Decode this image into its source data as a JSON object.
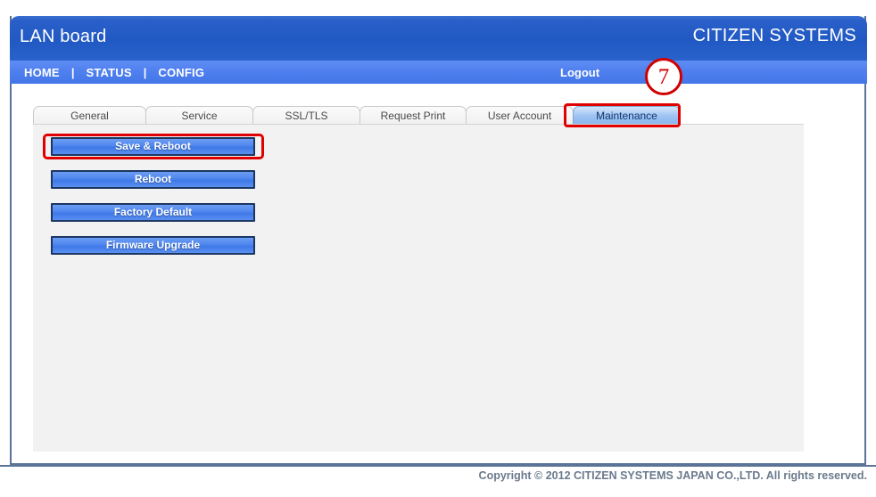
{
  "header": {
    "title": "LAN board",
    "brand": "CITIZEN SYSTEMS"
  },
  "nav": {
    "items": [
      {
        "label": "HOME"
      },
      {
        "label": "STATUS"
      },
      {
        "label": "CONFIG"
      }
    ],
    "separator": "|",
    "logout_label": "Logout"
  },
  "tabs": [
    {
      "label": "General",
      "active": false
    },
    {
      "label": "Service",
      "active": false
    },
    {
      "label": "SSL/TLS",
      "active": false
    },
    {
      "label": "Request Print",
      "active": false
    },
    {
      "label": "User Account",
      "active": false
    },
    {
      "label": "Maintenance",
      "active": true
    }
  ],
  "maintenance_panel": {
    "buttons": [
      {
        "label": "Save & Reboot"
      },
      {
        "label": "Reboot"
      },
      {
        "label": "Factory Default"
      },
      {
        "label": "Firmware Upgrade"
      }
    ]
  },
  "annotations": {
    "step_badge": "7",
    "highlight_color": "#e00000",
    "badge_color": "#d00000"
  },
  "footer": {
    "copyright": "Copyright © 2012 CITIZEN SYSTEMS JAPAN CO.,LTD. All rights reserved."
  },
  "colors": {
    "header_blue": "#2159c4",
    "nav_blue": "#5080ef",
    "panel_gray": "#f2f2f2",
    "frame_border": "#5b7498",
    "button_blue": "#4f86ee"
  }
}
